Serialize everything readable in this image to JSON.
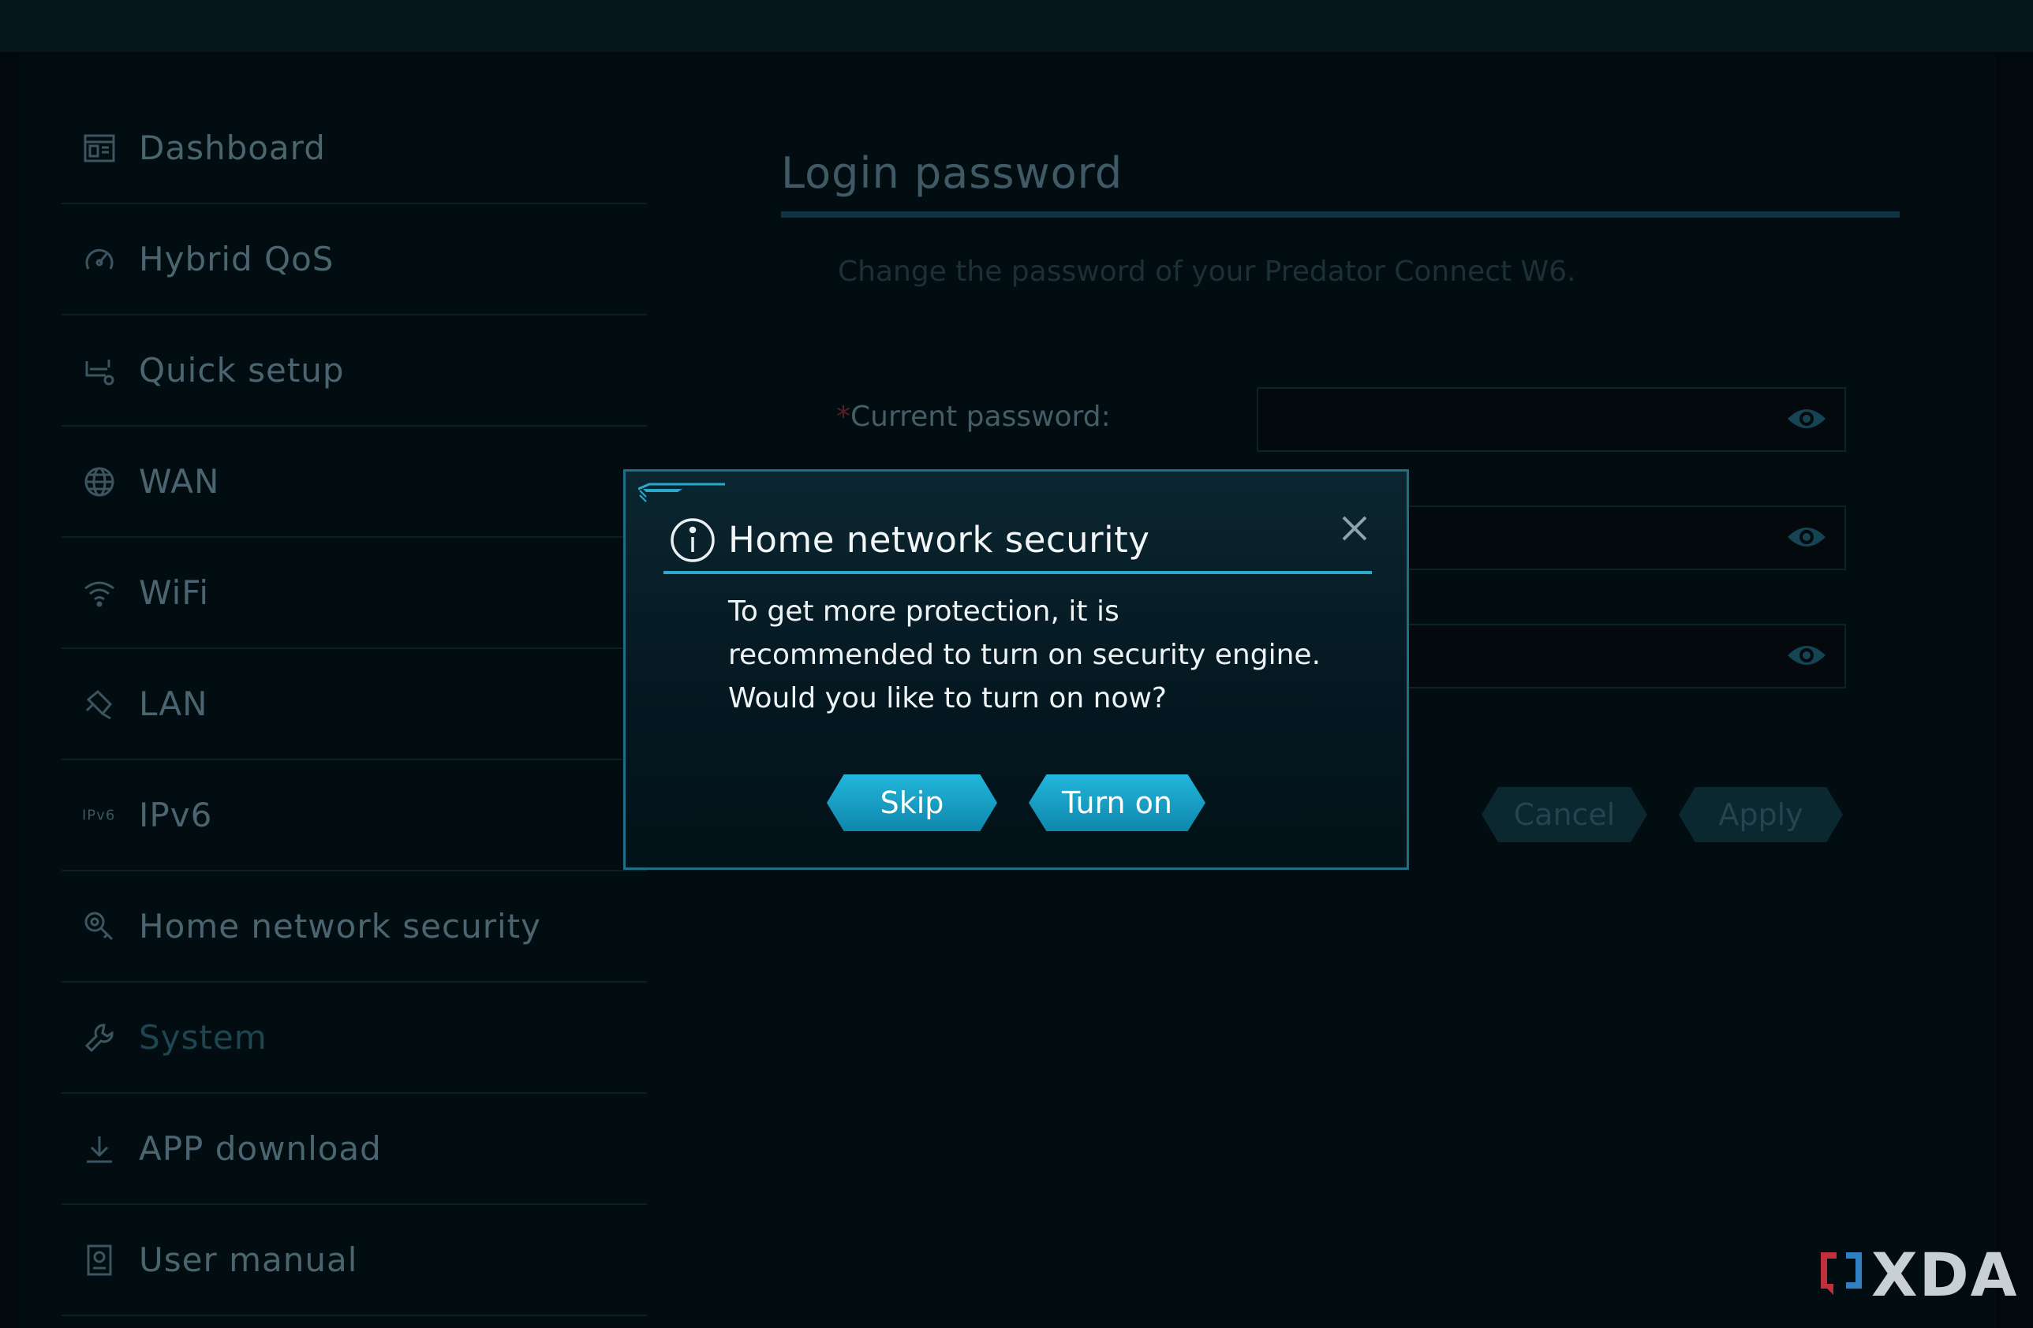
{
  "sidebar": {
    "items": [
      {
        "label": "Dashboard",
        "icon": "dashboard-icon"
      },
      {
        "label": "Hybrid QoS",
        "icon": "gauge-icon"
      },
      {
        "label": "Quick setup",
        "icon": "router-setup-icon"
      },
      {
        "label": "WAN",
        "icon": "globe-icon"
      },
      {
        "label": "WiFi",
        "icon": "wifi-icon"
      },
      {
        "label": "LAN",
        "icon": "lan-plug-icon"
      },
      {
        "label": "IPv6",
        "icon_text": "IPv6"
      },
      {
        "label": "Home network security",
        "icon": "shield-search-icon"
      },
      {
        "label": "System",
        "icon": "wrench-icon"
      },
      {
        "label": "APP download",
        "icon": "download-icon"
      },
      {
        "label": "User manual",
        "icon": "manual-icon"
      }
    ]
  },
  "main": {
    "title": "Login password",
    "subtitle": "Change the password of your Predator Connect W6.",
    "current_password_label": "Current password:",
    "required_mark": "*",
    "cancel_label": "Cancel",
    "apply_label": "Apply"
  },
  "modal": {
    "title": "Home network security",
    "body_lines": [
      "To get more protection, it is",
      "recommended to turn on security engine.",
      "Would you like to turn on now?"
    ],
    "skip_label": "Skip",
    "turn_on_label": "Turn on"
  },
  "watermark": {
    "text": "XDA"
  },
  "colors": {
    "accent": "#22b6dc",
    "modal_border": "#1d6f86",
    "background": "#02090c"
  }
}
